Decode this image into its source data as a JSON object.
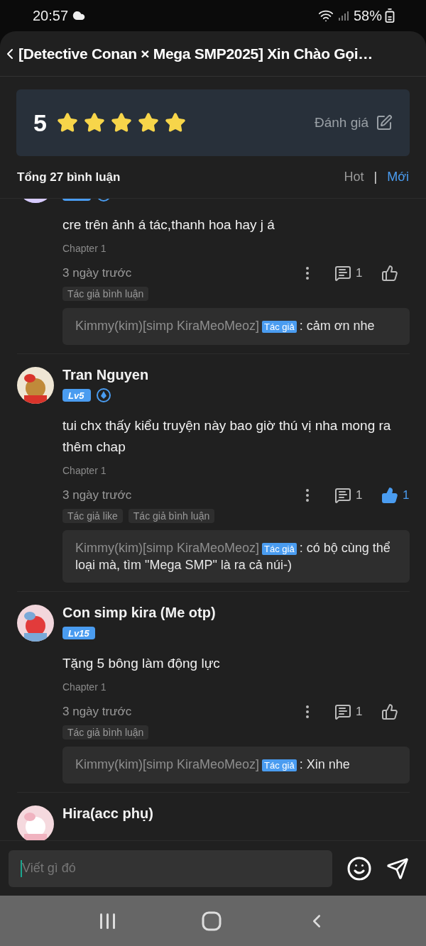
{
  "status_bar": {
    "time": "20:57",
    "battery": "58%"
  },
  "header": {
    "title": "[Detective Conan × Mega SMP2025] Xin Chào Gọi…"
  },
  "rating": {
    "score": "5",
    "stars": 5,
    "action": "Đánh giá"
  },
  "comments_header": {
    "total": "Tổng 27 bình luận",
    "separator": "|",
    "sorts": [
      {
        "label": "Hot",
        "selected": false
      },
      {
        "label": "Mới",
        "selected": true
      }
    ]
  },
  "comments": [
    {
      "kind": "cut",
      "verified": true,
      "text": "cre trên ảnh á tác,thanh hoa hay j á",
      "chapter": "Chapter 1",
      "time": "3 ngày trước",
      "reply_count": "1",
      "liked": false,
      "tags": [
        "Tác giả bình luận"
      ],
      "reply": {
        "author": "Kimmy(kim)[simp KiraMeoMeoz]",
        "badge": "Tác giả",
        "text": ": cảm ơn nhe"
      }
    },
    {
      "kind": "full",
      "name": "Tran Nguyen",
      "level": "Lv5",
      "verified": true,
      "text": "tui chx thấy kiểu truyện này bao giờ thú vị nha mong ra thêm chap",
      "chapter": "Chapter 1",
      "time": "3 ngày trước",
      "reply_count": "1",
      "liked": true,
      "like_count": "1",
      "tags": [
        "Tác giả like",
        "Tác giả bình luận"
      ],
      "reply": {
        "author": "Kimmy(kim)[simp KiraMeoMeoz]",
        "badge": "Tác giả",
        "text": ": có bộ cùng thể loại mà, tìm \"Mega SMP\" là ra cả núi-)"
      }
    },
    {
      "kind": "full",
      "name": "Con simp kira (Me otp)",
      "level": "Lv15",
      "verified": false,
      "text": "Tặng 5 bông làm động lực",
      "chapter": "Chapter 1",
      "time": "3 ngày trước",
      "reply_count": "1",
      "liked": false,
      "tags": [
        "Tác giả bình luận"
      ],
      "reply": {
        "author": "Kimmy(kim)[simp KiraMeoMeoz]",
        "badge": "Tác giả",
        "text": ": Xin nhe"
      }
    },
    {
      "kind": "full",
      "name": "Hira(acc phụ)",
      "verified": false
    }
  ],
  "composer": {
    "placeholder": "Viết gì đó"
  }
}
